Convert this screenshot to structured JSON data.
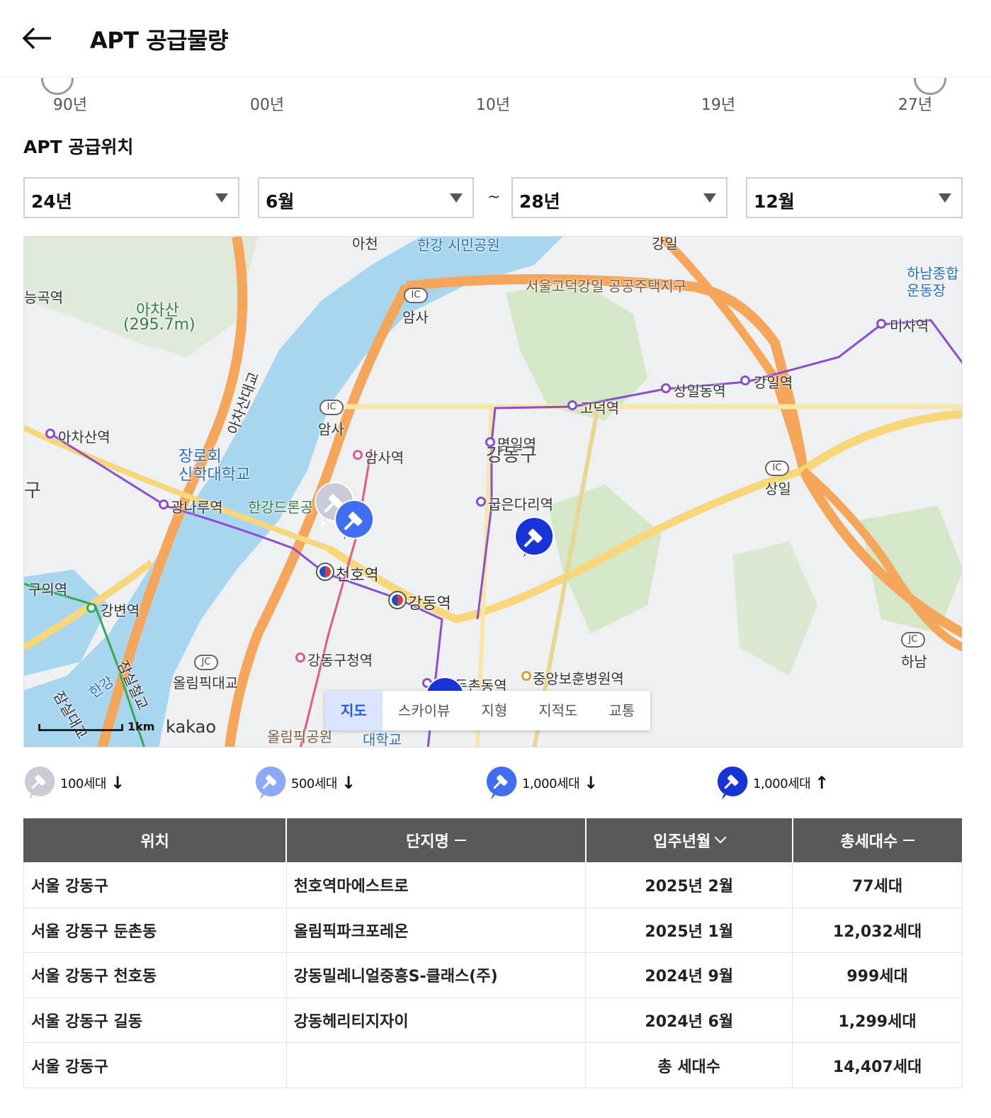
{
  "header": {
    "title": "APT 공급물량",
    "back_icon": "arrow-left-icon"
  },
  "timeline": {
    "ticks": [
      "90년",
      "00년",
      "10년",
      "19년",
      "27년"
    ]
  },
  "section": {
    "title": "APT 공급위치"
  },
  "filters": {
    "start_year": "24년",
    "start_month": "6월",
    "separator": "~",
    "end_year": "28년",
    "end_month": "12월"
  },
  "map": {
    "labels": {
      "achasan": "아차산",
      "achasan_elev": "(295.7m)",
      "achasan_station": "아차산역",
      "seminary_1": "장로회",
      "seminary_2": "신학대학교",
      "gwangnaru": "광나루역",
      "hangang_park": "한강드론공",
      "cheonho": "천호역",
      "gangdong": "강동역",
      "gangdong_office": "강동구청역",
      "amsa_station": "암사역",
      "amsa_ic": "암사",
      "amsa_ic2": "암사",
      "myeongil": "명일역",
      "district": "강동구",
      "gubeundari": "굽은다리역",
      "godeok": "고덕역",
      "sangildong": "상일동역",
      "gangil": "강일역",
      "misa": "미사역",
      "hanam_stadium_1": "하남종합",
      "hanam_stadium_2": "운동장",
      "godeok_district": "서울고덕강일 공공주택지구",
      "sangil_ic": "상일",
      "hanam_jc": "하남",
      "veterans": "중앙보훈병원역",
      "olympic_bridge": "올림픽대교",
      "olympic_park": "올림픽공원",
      "university": "대학교",
      "guui": "구의역",
      "gangbyeon": "강변역",
      "jamsil_bridge": "잠실대교",
      "jamsil_rail": "잠실철교",
      "hangang": "한강",
      "achasan_daero": "아차산대교",
      "ajeon": "아천",
      "gangil_top": "강일",
      "gokgu": "능곡역",
      "dunchon": "둔촌동역",
      "hangang_park_top": "한강 시민공원",
      "gu_partial": "구"
    },
    "ic": "IC",
    "jc": "JC",
    "scale": "1km",
    "brand": "kakao",
    "tabs": [
      "지도",
      "스카이뷰",
      "지형",
      "지적도",
      "교통"
    ],
    "active_tab": "지도",
    "colors": {
      "water": "#a9d6ef",
      "highway": "#f5a65b",
      "road": "#f7d77a",
      "park": "#d4e8c8",
      "line5": "#8a4fd1",
      "line8": "#e35a8a",
      "line2": "#34a853"
    }
  },
  "legend": [
    {
      "label": "100세대",
      "arrow": "↓",
      "color": "#c9ccd6"
    },
    {
      "label": "500세대",
      "arrow": "↓",
      "color": "#8fa8f5"
    },
    {
      "label": "1,000세대",
      "arrow": "↓",
      "color": "#3f6ef0"
    },
    {
      "label": "1,000세대",
      "arrow": "↑",
      "color": "#1634d8"
    }
  ],
  "table": {
    "headers": [
      "위치",
      "단지명",
      "입주년월",
      "총세대수"
    ],
    "rows": [
      [
        "서울 강동구",
        "천호역마에스트로",
        "2025년 2월",
        "77세대"
      ],
      [
        "서울 강동구 둔촌동",
        "올림픽파크포레온",
        "2025년 1월",
        "12,032세대"
      ],
      [
        "서울 강동구 천호동",
        "강동밀레니얼중흥S-클래스(주)",
        "2024년 9월",
        "999세대"
      ],
      [
        "서울 강동구 길동",
        "강동헤리티지자이",
        "2024년 6월",
        "1,299세대"
      ]
    ],
    "total": {
      "location": "서울 강동구",
      "label": "총 세대수",
      "value": "14,407세대"
    }
  }
}
